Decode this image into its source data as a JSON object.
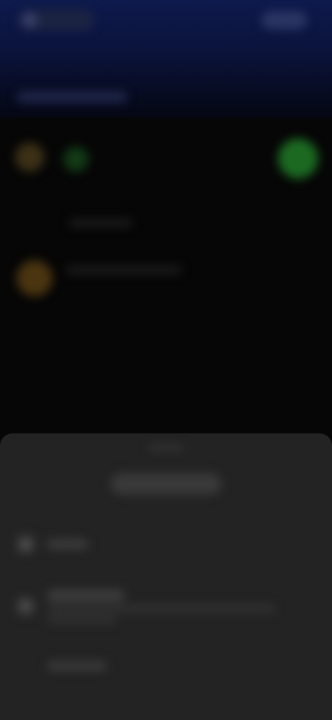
{
  "header": {
    "left_label": "",
    "right_label": ""
  },
  "list": {
    "section_title": "",
    "items": [
      {
        "title": "",
        "subtitle": ""
      },
      {
        "title": "",
        "subtitle": ""
      },
      {
        "title": "",
        "subtitle": ""
      }
    ]
  },
  "sheet": {
    "title": "",
    "items": [
      {
        "icon": "person-icon",
        "label": ""
      },
      {
        "icon": "edit-icon",
        "label": "",
        "sub": ""
      },
      {
        "icon": "",
        "label": ""
      }
    ]
  },
  "colors": {
    "top_gradient": "#0e1a4d",
    "background": "#060606",
    "sheet": "#232323",
    "accent_green": "#1f5a22",
    "accent_orange": "#5a3a12"
  }
}
